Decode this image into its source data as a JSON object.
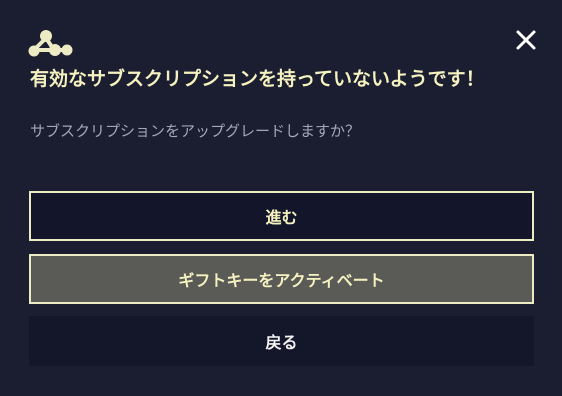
{
  "dialog": {
    "logo_icon": "molecule-logo-icon",
    "close_icon": "close-icon",
    "title": "有効なサブスクリプションを持っていないようです！",
    "message": "サブスクリプションをアップグレードしますか？",
    "buttons": {
      "proceed_label": "進む",
      "gift_key_label": "ギフトキーをアクティベート",
      "back_label": "戻る"
    }
  },
  "colors": {
    "background": "#1b1d30",
    "accent": "#f5f2c0",
    "muted_text": "#a4a6b8",
    "gift_button_bg": "#5a5a57",
    "dark_button_bg": "#13152a"
  }
}
